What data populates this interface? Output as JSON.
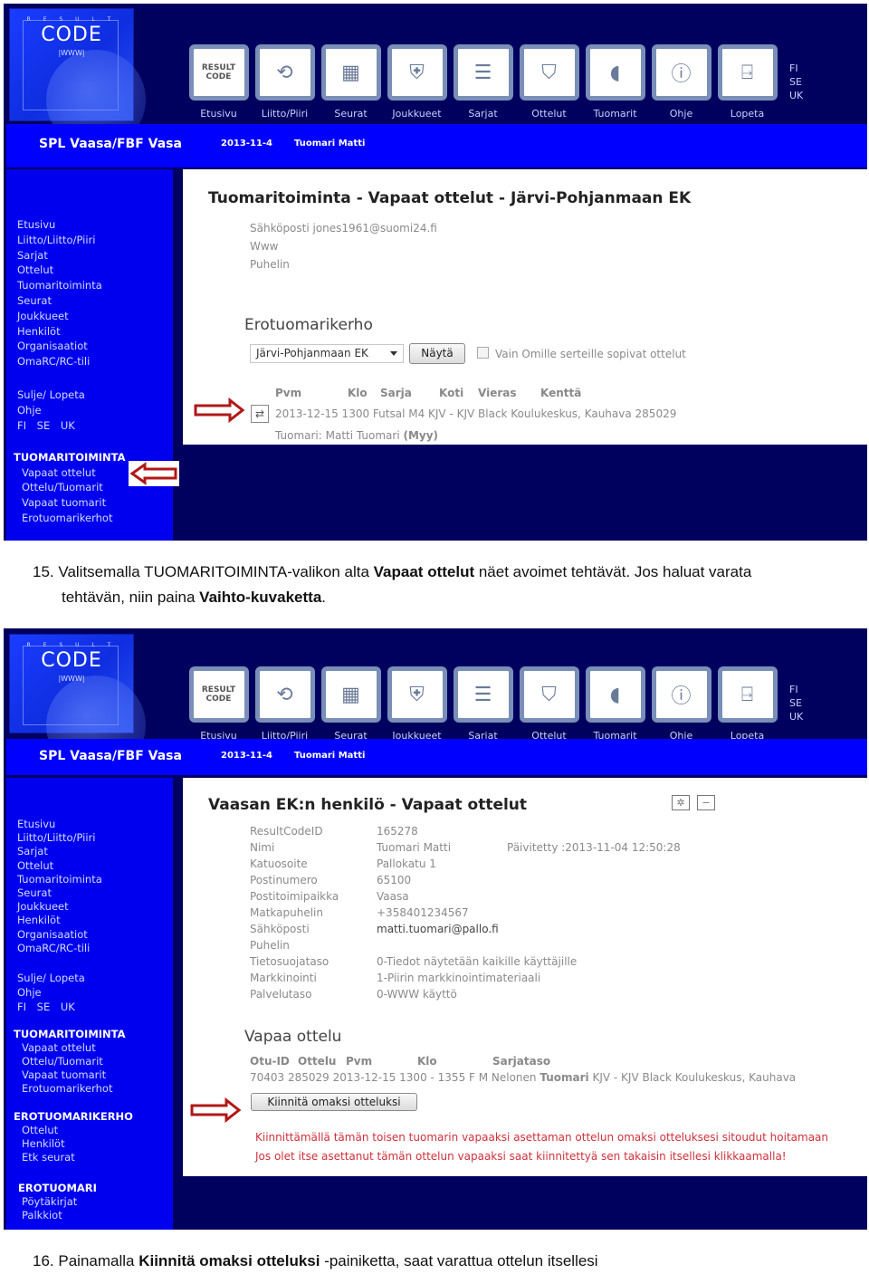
{
  "screenshot1": {
    "logo": {
      "top": "R E S U L T",
      "main": "CODE",
      "sub": "|WWW|"
    },
    "topnav": [
      {
        "label": "Etusivu",
        "icon": "resultcode-logo-icon"
      },
      {
        "label": "Liitto/Piiri",
        "icon": "network-icon"
      },
      {
        "label": "Seurat",
        "icon": "clubs-icon"
      },
      {
        "label": "Joukkueet",
        "icon": "team-shield-icon"
      },
      {
        "label": "Sarjat",
        "icon": "series-table-icon"
      },
      {
        "label": "Ottelut",
        "icon": "versus-icon"
      },
      {
        "label": "Tuomarit",
        "icon": "whistle-icon"
      },
      {
        "label": "Ohje",
        "icon": "info-icon"
      },
      {
        "label": "Lopeta",
        "icon": "exit-door-icon"
      }
    ],
    "languages": [
      "FI",
      "SE",
      "UK"
    ],
    "header": {
      "org": "SPL Vaasa/FBF Vasa",
      "date": "2013-11-4",
      "user": "Tuomari Matti"
    },
    "sidebar": {
      "main_links": [
        "Etusivu",
        "Liitto/Liitto/Piiri",
        "Sarjat",
        "Ottelut",
        "Tuomaritoiminta",
        "Seurat",
        "Joukkueet",
        "Henkilöt",
        "Organisaatiot",
        "OmaRC/RC-tili"
      ],
      "utility_links": [
        "Sulje/ Lopeta",
        "Ohje"
      ],
      "languages": "FI   SE   UK",
      "section_title": "TUOMARITOIMINTA",
      "section_links": [
        "Vapaat ottelut",
        "Ottelu/Tuomarit",
        "Vapaat tuomarit",
        "Erotuomarikerhot"
      ]
    },
    "content": {
      "title": "Tuomaritoiminta - Vapaat ottelut - Järvi-Pohjanmaan EK",
      "email": "Sähköposti jones1961@suomi24.fi",
      "www": "Www",
      "phone": "Puhelin",
      "club_section_title": "Erotuomarikerho",
      "club_select_value": "Järvi-Pohjanmaan EK",
      "show_button": "Näytä",
      "checkbox_label": "Vain Omille serteille sopivat ottelut",
      "checkbox_checked": false,
      "table_headers": [
        "Pvm",
        "Klo",
        "Sarja",
        "Koti",
        "Vieras",
        "Kenttä"
      ],
      "match_row": "2013-12-15 1300 Futsal M4  KJV - KJV Black Koulukeskus, Kauhava 285029",
      "referee_prefix": "Tuomari: Matti Tuomari ",
      "referee_role": "(Myy)"
    }
  },
  "caption15": {
    "number": "15.",
    "part1": "Valitsemalla TUOMARITOIMINTA-valikon alta ",
    "bold1": "Vapaat ottelut",
    "part2": " näet avoimet tehtävät. Jos haluat varata",
    "part3": "tehtävän, niin paina ",
    "bold2": "Vaihto-kuvaketta",
    "part4": "."
  },
  "screenshot2": {
    "header": {
      "org": "SPL Vaasa/FBF Vasa",
      "date": "2013-11-4",
      "user": "Tuomari Matti"
    },
    "sidebar": {
      "main_links": [
        "Etusivu",
        "Liitto/Liitto/Piiri",
        "Sarjat",
        "Ottelut",
        "Tuomaritoiminta",
        "Seurat",
        "Joukkueet",
        "Henkilöt",
        "Organisaatiot",
        "OmaRC/RC-tili"
      ],
      "utility_links": [
        "Sulje/ Lopeta",
        "Ohje"
      ],
      "languages": "FI   SE   UK",
      "sections": [
        {
          "title": "TUOMARITOIMINTA",
          "links": [
            "Vapaat ottelut",
            "Ottelu/Tuomarit",
            "Vapaat tuomarit",
            "Erotuomarikerhot"
          ]
        },
        {
          "title": "EROTUOMARIKERHO",
          "links": [
            "Ottelut",
            "Henkilöt",
            "Etk seurat"
          ]
        },
        {
          "title": "EROTUOMARI",
          "links": [
            "Pöytäkirjat",
            "Palkkiot"
          ]
        }
      ]
    },
    "content": {
      "title": "Vaasan EK:n henkilö - Vapaat ottelut",
      "updated": "Päivitetty :2013-11-04 12:50:28",
      "fields": [
        {
          "label": "ResultCodeID",
          "value": "165278"
        },
        {
          "label": "Nimi",
          "value": "Tuomari Matti"
        },
        {
          "label": "Katuosoite",
          "value": "Pallokatu 1"
        },
        {
          "label": "Postinumero",
          "value": "65100"
        },
        {
          "label": "Postitoimipaikka",
          "value": "Vaasa"
        },
        {
          "label": "Matkapuhelin",
          "value": "+358401234567"
        },
        {
          "label": "Sähköposti",
          "value": "matti.tuomari@pallo.fi"
        },
        {
          "label": "Puhelin",
          "value": ""
        },
        {
          "label": "Tietosuojataso",
          "value": "0-Tiedot näytetään kaikille käyttäjille"
        },
        {
          "label": "Markkinointi",
          "value": "1-Piirin markkinointimateriaali"
        },
        {
          "label": "Palvelutaso",
          "value": "0-WWW käyttö"
        }
      ],
      "free_match_title": "Vapaa ottelu",
      "free_match_headers": [
        "Otu-ID",
        "Ottelu",
        "Pvm",
        "Klo",
        "Sarjataso"
      ],
      "free_match_row_pre": "70403   285029 2013-12-15 1300 - 1355 F M Nelonen ",
      "free_match_row_bold": "Tuomari",
      "free_match_row_post": " KJV - KJV Black Koulukeskus, Kauhava",
      "claim_button": "Kiinnitä omaksi otteluksi",
      "warning1": "Kiinnittämällä tämän toisen tuomarin vapaaksi asettaman ottelun omaksi otteluksesi sitoudut hoitamaan",
      "warning2": "Jos olet itse asettanut tämän ottelun vapaaksi saat kiinnitettyä sen takaisin itsellesi klikkaamalla!"
    }
  },
  "caption16": {
    "number": "16.",
    "part1": "Painamalla ",
    "bold1": "Kiinnitä omaksi otteluksi",
    "part2": " -painiketta, saat varattua ottelun itsellesi"
  },
  "colors": {
    "navy": "#00005e",
    "blue": "#0000ff",
    "sidebar": "#0000ee",
    "arrow_red": "#b01818",
    "warning_red": "#d0303a"
  }
}
